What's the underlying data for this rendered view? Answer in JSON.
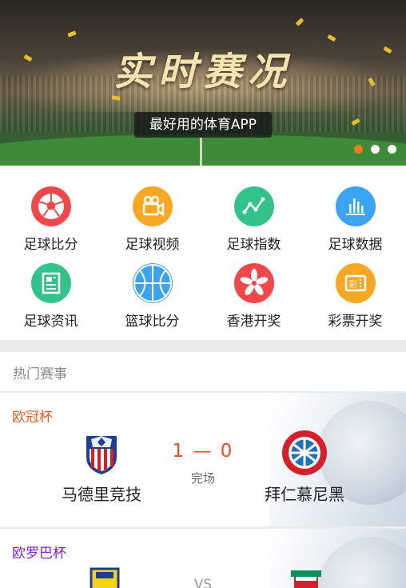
{
  "banner": {
    "title": "实时赛况",
    "subtitle": "最好用的体育APP",
    "slides": 3,
    "active_slide": 1
  },
  "menu": [
    {
      "label": "足球比分",
      "icon": "soccer-ball-icon",
      "color": "#f0484a"
    },
    {
      "label": "足球视频",
      "icon": "video-camera-icon",
      "color": "#f7a823"
    },
    {
      "label": "足球指数",
      "icon": "line-chart-icon",
      "color": "#32c28a"
    },
    {
      "label": "足球数据",
      "icon": "bar-chart-icon",
      "color": "#3aa3f2"
    },
    {
      "label": "足球资讯",
      "icon": "newspaper-icon",
      "color": "#32c28a"
    },
    {
      "label": "篮球比分",
      "icon": "basketball-icon",
      "color": "#3aa3f2"
    },
    {
      "label": "香港开奖",
      "icon": "bauhinia-icon",
      "color": "#f0484a"
    },
    {
      "label": "彩票开奖",
      "icon": "lottery-ticket-icon",
      "color": "#f7a823"
    }
  ],
  "hot_section": {
    "title": "热门赛事"
  },
  "matches": [
    {
      "league": "欧冠杯",
      "league_color": "#f05a1a",
      "home": "马德里竞技",
      "away": "拜仁慕尼黑",
      "score": "1 — 0",
      "status": "完场"
    },
    {
      "league": "欧罗巴杯",
      "league_color": "#8a1fd1",
      "home": "",
      "away": "",
      "score": "VS",
      "status": ""
    }
  ],
  "colors": {
    "accent": "#f47a20",
    "score": "#f04a22"
  }
}
